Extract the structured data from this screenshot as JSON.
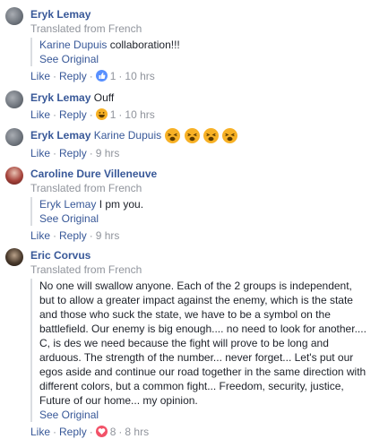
{
  "comments": [
    {
      "author": "Eryk Lemay",
      "translated": "Translated from French",
      "quote_mention": "Karine Dupuis",
      "quote_text": "collaboration!!!",
      "see_original": "See Original",
      "like": "Like",
      "reply": "Reply",
      "reaction": "like",
      "reaction_count": "1",
      "time": "10 hrs"
    },
    {
      "author": "Eryk Lemay",
      "text": "Ouff",
      "like": "Like",
      "reply": "Reply",
      "reaction": "laugh",
      "reaction_count": "1",
      "time": "10 hrs"
    },
    {
      "author": "Eryk Lemay",
      "mention": "Karine Dupuis",
      "emoji": [
        "tired-face",
        "tired-face",
        "tired-face",
        "tired-face"
      ],
      "like": "Like",
      "reply": "Reply",
      "time": "9 hrs"
    },
    {
      "author": "Caroline Dure Villeneuve",
      "translated": "Translated from French",
      "quote_mention": "Eryk Lemay",
      "quote_text": "I pm you.",
      "see_original": "See Original",
      "like": "Like",
      "reply": "Reply",
      "time": "9 hrs"
    },
    {
      "author": "Eric Corvus",
      "translated": "Translated from French",
      "quote_lines": [
        "No one will swallow anyone. Each of the 2 groups is independent,",
        "but to allow a greater impact against the enemy, which is the state",
        "and those who suck the state, we have to be a symbol on the",
        "battlefield. Our enemy is big enough.... no need to look for another....",
        "C, is des we need because the fight will prove to be long and",
        "arduous. The strength of the number... never forget... Let's put our",
        "egos aside and continue our road together in the same direction with",
        "different colors, but a common fight... Freedom, security, justice,",
        "Future of our home... my opinion."
      ],
      "see_original": "See Original",
      "like": "Like",
      "reply": "Reply",
      "reaction": "love",
      "reaction_count": "8",
      "time": "8 hrs"
    }
  ],
  "separator": "·",
  "colors": {
    "link": "#385898",
    "meta": "#90949c",
    "text": "#1d2129"
  }
}
